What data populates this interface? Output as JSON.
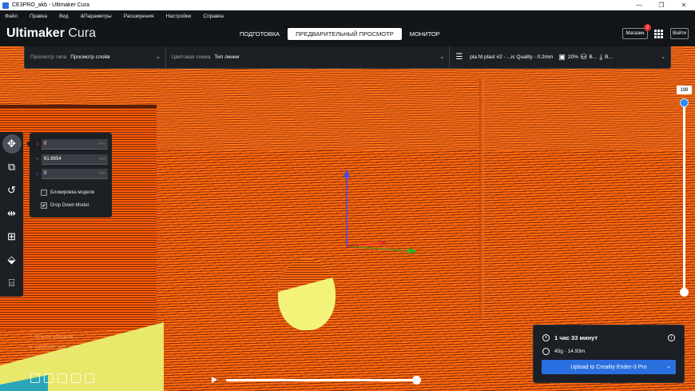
{
  "window": {
    "title": "CE3PRO_akb - Ultimaker Cura",
    "controls": [
      "—",
      "❐",
      "✕"
    ]
  },
  "menu": [
    "Файл",
    "Правка",
    "Вид",
    "&Параметры",
    "Расширения",
    "Настройки",
    "Справка"
  ],
  "header": {
    "brand_bold": "Ultimaker",
    "brand_light": " Cura",
    "tabs": [
      {
        "label": "ПОДГОТОВКА",
        "active": false
      },
      {
        "label": "ПРЕДВАРИТЕЛЬНЫЙ ПРОСМОТР",
        "active": true
      },
      {
        "label": "МОНИТОР",
        "active": false
      }
    ],
    "store_label": "Магазин",
    "store_badge": "2",
    "signin_label": "Войти"
  },
  "toolbar": {
    "view_type_label": "Просмотр типа",
    "view_type_value": "Просмотр слоёв",
    "color_scheme_label": "Цветовая схема",
    "color_scheme_value": "Тип линии",
    "profile": "pla fd plast #2 - ...ic Quality - 0.2mm",
    "infill": "20%",
    "support": "В...",
    "adhesion": "В..."
  },
  "move_panel": {
    "x_label": "X",
    "y_label": "Y",
    "z_label": "Z",
    "x_value": "0",
    "y_value": "61.6654",
    "z_value": "0",
    "unit": "mm",
    "lock_label": "Блокировка модели",
    "lock_checked": false,
    "dropdown_label": "Drop Down Model",
    "dropdown_checked": true
  },
  "layer_slider": {
    "current_layer": "198",
    "max_level": 1.0
  },
  "object_list": {
    "toggle_label": "Список объектов",
    "object_name": "CE3PRO_akb",
    "dimensions": "0.0 x 74.0 x 88.0 мм"
  },
  "print_info": {
    "time": "1 час 33 минут",
    "material": "45g · 14.93m",
    "upload_label": "Upload to Creality Ender-3 Pro"
  },
  "colors": {
    "accent": "#2a6fe0",
    "panel": "#1c2025",
    "wall_orange": "#ff6a10",
    "skin_yellow": "#f3f37a"
  }
}
